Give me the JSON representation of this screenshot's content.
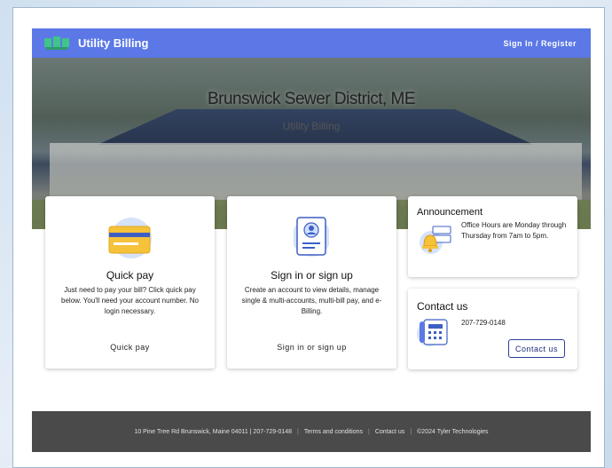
{
  "header": {
    "brand_name": "Utility Billing",
    "signin_label": "Sign In / Register"
  },
  "hero": {
    "title": "Brunswick Sewer District, ME",
    "subtitle": "Utility Billing"
  },
  "quick_pay": {
    "title": "Quick pay",
    "description": "Just need to pay your bill? Click quick pay below. You'll need your account number. No login necessary.",
    "action_label": "Quick pay",
    "icon": "credit-card-icon"
  },
  "signin_card": {
    "title": "Sign in or sign up",
    "description": "Create an account to view details, manage single & multi-accounts, multi-bill pay, and e-Billing.",
    "action_label": "Sign in or sign up",
    "icon": "user-badge-icon"
  },
  "announcement": {
    "title": "Announcement",
    "text": "Office Hours are Monday through Thursday from 7am to 5pm.",
    "icon": "bell-notification-icon"
  },
  "contact": {
    "title": "Contact us",
    "phone": "207-729-0148",
    "button_label": "Contact us",
    "icon": "phone-icon"
  },
  "footer": {
    "address": "10 Pine Tree Rd Brunswick, Maine 04011 | 207-729-0148",
    "terms_label": "Terms and conditions",
    "contact_label": "Contact us",
    "copyright": "©2024 Tyler Technologies"
  },
  "colors": {
    "header_bg": "#5b78e6",
    "logo_green": "#3fc48a",
    "footer_bg": "#4a4a4a",
    "button_border": "#2d3e9b"
  }
}
